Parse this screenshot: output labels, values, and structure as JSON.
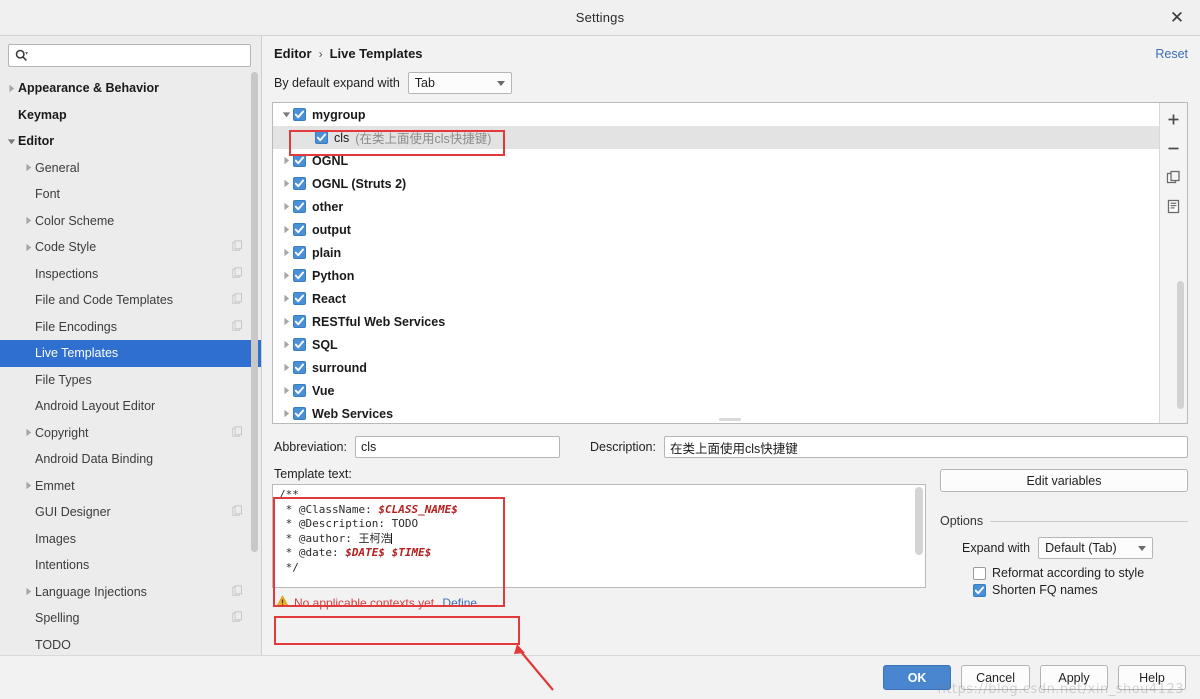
{
  "window": {
    "title": "Settings",
    "close_icon": "close-icon"
  },
  "search": {
    "value": "",
    "placeholder": "",
    "icon": "search-icon"
  },
  "sidebar": {
    "items": [
      {
        "label": "Appearance & Behavior",
        "level": 0,
        "arrow": "collapsed",
        "bold": true,
        "selected": false,
        "cfg": false
      },
      {
        "label": "Keymap",
        "level": 0,
        "arrow": "none",
        "bold": true,
        "selected": false,
        "cfg": false
      },
      {
        "label": "Editor",
        "level": 0,
        "arrow": "expanded",
        "bold": true,
        "selected": false,
        "cfg": false
      },
      {
        "label": "General",
        "level": 1,
        "arrow": "collapsed",
        "bold": false,
        "selected": false,
        "cfg": false
      },
      {
        "label": "Font",
        "level": 1,
        "arrow": "none",
        "bold": false,
        "selected": false,
        "cfg": false
      },
      {
        "label": "Color Scheme",
        "level": 1,
        "arrow": "collapsed",
        "bold": false,
        "selected": false,
        "cfg": false
      },
      {
        "label": "Code Style",
        "level": 1,
        "arrow": "collapsed",
        "bold": false,
        "selected": false,
        "cfg": true
      },
      {
        "label": "Inspections",
        "level": 1,
        "arrow": "none",
        "bold": false,
        "selected": false,
        "cfg": true
      },
      {
        "label": "File and Code Templates",
        "level": 1,
        "arrow": "none",
        "bold": false,
        "selected": false,
        "cfg": true
      },
      {
        "label": "File Encodings",
        "level": 1,
        "arrow": "none",
        "bold": false,
        "selected": false,
        "cfg": true
      },
      {
        "label": "Live Templates",
        "level": 1,
        "arrow": "none",
        "bold": false,
        "selected": true,
        "cfg": false
      },
      {
        "label": "File Types",
        "level": 1,
        "arrow": "none",
        "bold": false,
        "selected": false,
        "cfg": false
      },
      {
        "label": "Android Layout Editor",
        "level": 1,
        "arrow": "none",
        "bold": false,
        "selected": false,
        "cfg": false
      },
      {
        "label": "Copyright",
        "level": 1,
        "arrow": "collapsed",
        "bold": false,
        "selected": false,
        "cfg": true
      },
      {
        "label": "Android Data Binding",
        "level": 1,
        "arrow": "none",
        "bold": false,
        "selected": false,
        "cfg": false
      },
      {
        "label": "Emmet",
        "level": 1,
        "arrow": "collapsed",
        "bold": false,
        "selected": false,
        "cfg": false
      },
      {
        "label": "GUI Designer",
        "level": 1,
        "arrow": "none",
        "bold": false,
        "selected": false,
        "cfg": true
      },
      {
        "label": "Images",
        "level": 1,
        "arrow": "none",
        "bold": false,
        "selected": false,
        "cfg": false
      },
      {
        "label": "Intentions",
        "level": 1,
        "arrow": "none",
        "bold": false,
        "selected": false,
        "cfg": false
      },
      {
        "label": "Language Injections",
        "level": 1,
        "arrow": "collapsed",
        "bold": false,
        "selected": false,
        "cfg": true
      },
      {
        "label": "Spelling",
        "level": 1,
        "arrow": "none",
        "bold": false,
        "selected": false,
        "cfg": true
      },
      {
        "label": "TODO",
        "level": 1,
        "arrow": "none",
        "bold": false,
        "selected": false,
        "cfg": false
      }
    ]
  },
  "breadcrumb": {
    "parent": "Editor",
    "separator": "›",
    "current": "Live Templates",
    "reset_label": "Reset"
  },
  "expand_with": {
    "label": "By default expand with",
    "value": "Tab"
  },
  "templates_list": {
    "rows": [
      {
        "label": "mygroup",
        "desc": "",
        "checked": true,
        "arrow": "expanded",
        "child": false,
        "selected": false
      },
      {
        "label": "cls",
        "desc": "(在类上面使用cls快捷键)",
        "checked": true,
        "arrow": "none",
        "child": true,
        "selected": true
      },
      {
        "label": "OGNL",
        "desc": "",
        "checked": true,
        "arrow": "collapsed",
        "child": false,
        "selected": false
      },
      {
        "label": "OGNL (Struts 2)",
        "desc": "",
        "checked": true,
        "arrow": "collapsed",
        "child": false,
        "selected": false
      },
      {
        "label": "other",
        "desc": "",
        "checked": true,
        "arrow": "collapsed",
        "child": false,
        "selected": false
      },
      {
        "label": "output",
        "desc": "",
        "checked": true,
        "arrow": "collapsed",
        "child": false,
        "selected": false
      },
      {
        "label": "plain",
        "desc": "",
        "checked": true,
        "arrow": "collapsed",
        "child": false,
        "selected": false
      },
      {
        "label": "Python",
        "desc": "",
        "checked": true,
        "arrow": "collapsed",
        "child": false,
        "selected": false
      },
      {
        "label": "React",
        "desc": "",
        "checked": true,
        "arrow": "collapsed",
        "child": false,
        "selected": false
      },
      {
        "label": "RESTful Web Services",
        "desc": "",
        "checked": true,
        "arrow": "collapsed",
        "child": false,
        "selected": false
      },
      {
        "label": "SQL",
        "desc": "",
        "checked": true,
        "arrow": "collapsed",
        "child": false,
        "selected": false
      },
      {
        "label": "surround",
        "desc": "",
        "checked": true,
        "arrow": "collapsed",
        "child": false,
        "selected": false
      },
      {
        "label": "Vue",
        "desc": "",
        "checked": true,
        "arrow": "collapsed",
        "child": false,
        "selected": false
      },
      {
        "label": "Web Services",
        "desc": "",
        "checked": true,
        "arrow": "collapsed",
        "child": false,
        "selected": false
      }
    ],
    "tools": [
      {
        "name": "add-template-button",
        "glyph": "+"
      },
      {
        "name": "remove-template-button",
        "glyph": "−"
      },
      {
        "name": "duplicate-template-button",
        "glyph": "copy"
      },
      {
        "name": "copy-settings-button",
        "glyph": "doc"
      }
    ]
  },
  "fields": {
    "abbreviation_label": "Abbreviation:",
    "abbreviation_value": "cls",
    "description_label": "Description:",
    "description_value": "在类上面使用cls快捷键"
  },
  "template_text": {
    "label": "Template text:",
    "lines": [
      {
        "parts": [
          {
            "t": "/**",
            "v": false
          }
        ]
      },
      {
        "parts": [
          {
            "t": " * @ClassName: ",
            "v": false
          },
          {
            "t": "$CLASS_NAME$",
            "v": true
          }
        ]
      },
      {
        "parts": [
          {
            "t": " * @Description: TODO",
            "v": false
          }
        ]
      },
      {
        "parts": [
          {
            "t": " * @author: 王柯浩",
            "v": false
          },
          {
            "t": "CARET",
            "v": false
          }
        ]
      },
      {
        "parts": [
          {
            "t": " * @date: ",
            "v": false
          },
          {
            "t": "$DATE$ $TIME$",
            "v": true
          }
        ]
      },
      {
        "parts": [
          {
            "t": " */",
            "v": false
          }
        ]
      }
    ],
    "plain": "/**\n * @ClassName: $CLASS_NAME$\n * @Description: TODO\n * @author: 王柯浩\n * @date: $DATE$ $TIME$\n */"
  },
  "context_warning": {
    "icon": "warning-icon",
    "text": "No applicable contexts yet.",
    "link": "Define"
  },
  "options": {
    "edit_variables_label": "Edit variables",
    "group_label": "Options",
    "expand_with_label": "Expand with",
    "expand_with_value": "Default (Tab)",
    "reformat_label": "Reformat according to style",
    "reformat_checked": false,
    "shorten_label": "Shorten FQ names",
    "shorten_checked": true
  },
  "footer": {
    "ok": "OK",
    "cancel": "Cancel",
    "apply": "Apply",
    "help": "Help"
  },
  "watermark": "https://blog.csdn.net/xin_shou4123",
  "colors": {
    "accent": "#4a86d0",
    "selection": "#2f6fd0",
    "link": "#3c6eb4",
    "annotation": "#e23a3a",
    "warning_text": "#cf4040",
    "variable": "#b32020"
  }
}
